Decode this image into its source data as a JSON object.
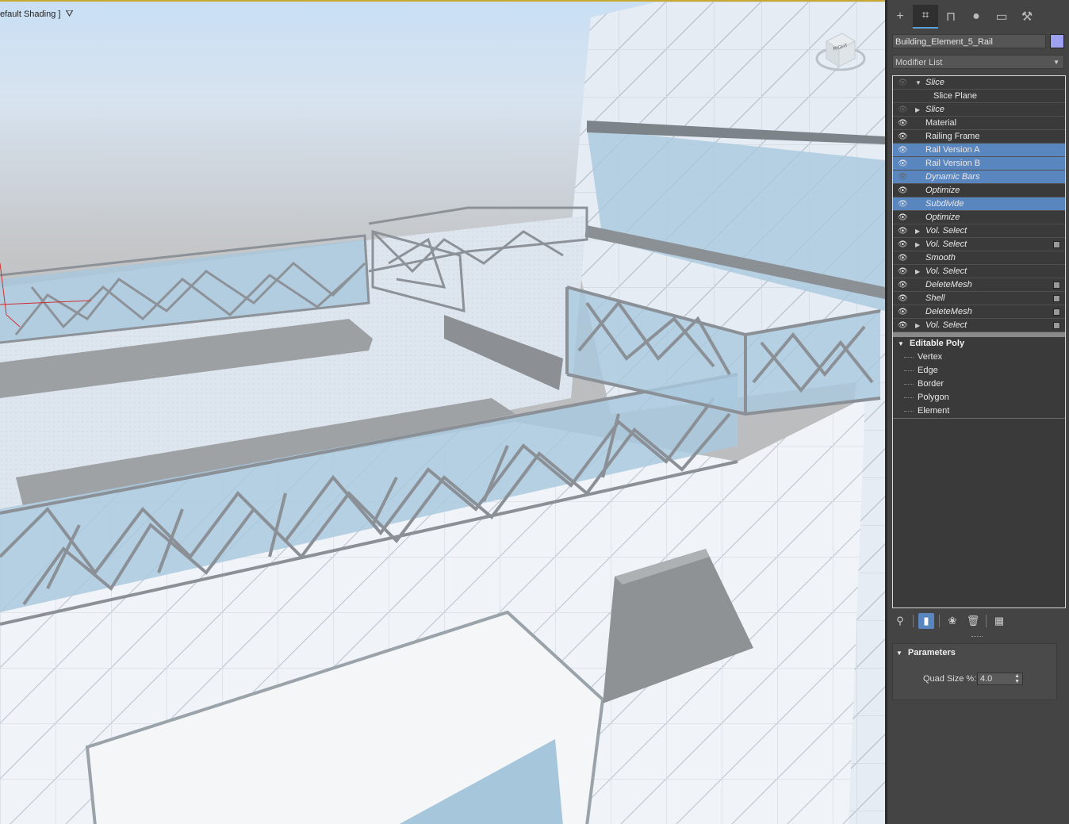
{
  "viewport": {
    "shading_label": "efault Shading ]",
    "viewcube_face": "RIGHT"
  },
  "panel": {
    "tabs": [
      {
        "name": "create-tab",
        "icon": "plus-icon",
        "glyph": "+"
      },
      {
        "name": "modify-tab",
        "icon": "modify-icon",
        "glyph": "⌗"
      },
      {
        "name": "hierarchy-tab",
        "icon": "hierarchy-icon",
        "glyph": "⊓"
      },
      {
        "name": "motion-tab",
        "icon": "motion-icon",
        "glyph": "●"
      },
      {
        "name": "display-tab",
        "icon": "display-icon",
        "glyph": "▭"
      },
      {
        "name": "utilities-tab",
        "icon": "wrench-icon",
        "glyph": "⚒"
      }
    ],
    "object_name": "Building_Element_5_Rail",
    "object_color": "#9ea0f0",
    "modifier_list_label": "Modifier List",
    "stack": [
      {
        "label": "Slice",
        "italic": true,
        "eye": "off",
        "triangle": "▼",
        "selected": false,
        "checkbox": false
      },
      {
        "label": "Slice Plane",
        "italic": false,
        "eye": "none",
        "triangle": "",
        "selected": false,
        "checkbox": false,
        "sub": true
      },
      {
        "label": "Slice",
        "italic": true,
        "eye": "off",
        "triangle": "▶",
        "selected": false,
        "checkbox": false
      },
      {
        "label": "Material",
        "italic": false,
        "eye": "on",
        "triangle": "",
        "selected": false,
        "checkbox": false
      },
      {
        "label": "Railing Frame",
        "italic": false,
        "eye": "on",
        "triangle": "",
        "selected": false,
        "checkbox": false
      },
      {
        "label": "Rail Version A",
        "italic": false,
        "eye": "on",
        "triangle": "",
        "selected": true,
        "checkbox": false
      },
      {
        "label": "Rail Version B",
        "italic": false,
        "eye": "on",
        "triangle": "",
        "selected": true,
        "checkbox": false
      },
      {
        "label": "Dynamic Bars",
        "italic": true,
        "eye": "off",
        "triangle": "",
        "selected": true,
        "checkbox": false
      },
      {
        "label": "Optimize",
        "italic": true,
        "eye": "on",
        "triangle": "",
        "selected": false,
        "checkbox": false
      },
      {
        "label": "Subdivide",
        "italic": true,
        "eye": "on",
        "triangle": "",
        "selected": true,
        "checkbox": false
      },
      {
        "label": "Optimize",
        "italic": true,
        "eye": "on",
        "triangle": "",
        "selected": false,
        "checkbox": false
      },
      {
        "label": "Vol. Select",
        "italic": true,
        "eye": "on",
        "triangle": "▶",
        "selected": false,
        "checkbox": false
      },
      {
        "label": "Vol. Select",
        "italic": true,
        "eye": "on",
        "triangle": "▶",
        "selected": false,
        "checkbox": true
      },
      {
        "label": "Smooth",
        "italic": true,
        "eye": "on",
        "triangle": "",
        "selected": false,
        "checkbox": false
      },
      {
        "label": "Vol. Select",
        "italic": true,
        "eye": "on",
        "triangle": "▶",
        "selected": false,
        "checkbox": false
      },
      {
        "label": "DeleteMesh",
        "italic": true,
        "eye": "on",
        "triangle": "",
        "selected": false,
        "checkbox": true
      },
      {
        "label": "Shell",
        "italic": true,
        "eye": "on",
        "triangle": "",
        "selected": false,
        "checkbox": true
      },
      {
        "label": "DeleteMesh",
        "italic": true,
        "eye": "on",
        "triangle": "",
        "selected": false,
        "checkbox": true
      },
      {
        "label": "Vol. Select",
        "italic": true,
        "eye": "on",
        "triangle": "▶",
        "selected": false,
        "checkbox": true
      }
    ],
    "editable_poly": {
      "label": "Editable Poly",
      "subobjects": [
        "Vertex",
        "Edge",
        "Border",
        "Polygon",
        "Element"
      ]
    },
    "toolbar": [
      {
        "name": "pin-stack-button",
        "icon": "pin-icon",
        "glyph": "⚲",
        "active": false
      },
      {
        "name": "show-end-result-button",
        "icon": "end-result-icon",
        "glyph": "▮",
        "active": true
      },
      {
        "name": "make-unique-button",
        "icon": "make-unique-icon",
        "glyph": "❀",
        "active": false
      },
      {
        "name": "remove-modifier-button",
        "icon": "trash-icon",
        "glyph": "🗑",
        "active": false
      },
      {
        "name": "configure-sets-button",
        "icon": "configure-icon",
        "glyph": "▦",
        "active": false
      }
    ],
    "parameters": {
      "title": "Parameters",
      "quad_size_label": "Quad Size %:",
      "quad_size_value": "4.0"
    }
  }
}
